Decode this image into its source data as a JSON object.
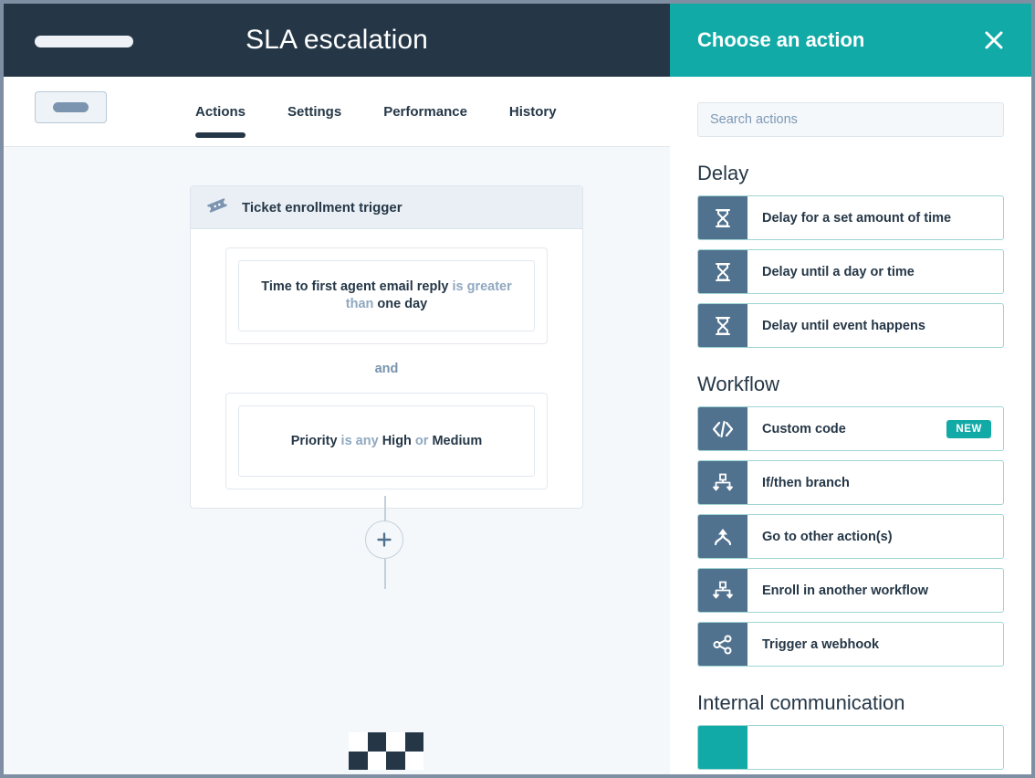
{
  "window": {
    "title": "SLA escalation"
  },
  "topbar": {
    "title": "SLA escalation",
    "left_pill": ""
  },
  "tabs": {
    "back_button_label": "",
    "items": [
      {
        "label": "Actions",
        "active": true
      },
      {
        "label": "Settings",
        "active": false
      },
      {
        "label": "Performance",
        "active": false
      },
      {
        "label": "History",
        "active": false
      }
    ]
  },
  "canvas": {
    "trigger": {
      "title": "Ticket enrollment trigger",
      "icon": "ticket-icon",
      "filters": [
        {
          "parts": [
            {
              "text": "Time to first agent email reply",
              "style": "bold"
            },
            {
              "text": " is greater than ",
              "style": "op"
            },
            {
              "text": "one day",
              "style": "bold"
            }
          ],
          "plain": "Time to first agent email reply is greater than one day"
        },
        {
          "parts": [
            {
              "text": "Priority",
              "style": "bold"
            },
            {
              "text": " is any ",
              "style": "op"
            },
            {
              "text": "High",
              "style": "bold"
            },
            {
              "text": " or ",
              "style": "op"
            },
            {
              "text": "Medium",
              "style": "bold"
            }
          ],
          "plain": "Priority is any High or Medium"
        }
      ],
      "conjunction": "and"
    },
    "add_action_button": "+"
  },
  "panel": {
    "title": "Choose an action",
    "close_icon": "close-icon",
    "search": {
      "placeholder": "Search actions",
      "value": ""
    },
    "sections": [
      {
        "title": "Delay",
        "items": [
          {
            "label": "Delay for a set amount of time",
            "icon": "hourglass-icon",
            "icon_color": "#51728f",
            "badge": ""
          },
          {
            "label": "Delay until a day or time",
            "icon": "hourglass-icon",
            "icon_color": "#51728f",
            "badge": ""
          },
          {
            "label": "Delay until event happens",
            "icon": "hourglass-icon",
            "icon_color": "#51728f",
            "badge": ""
          }
        ]
      },
      {
        "title": "Workflow",
        "items": [
          {
            "label": "Custom code",
            "icon": "code-icon",
            "icon_color": "#51728f",
            "badge": "NEW"
          },
          {
            "label": "If/then branch",
            "icon": "branch-icon",
            "icon_color": "#51728f",
            "badge": ""
          },
          {
            "label": "Go to other action(s)",
            "icon": "merge-arrow-icon",
            "icon_color": "#51728f",
            "badge": ""
          },
          {
            "label": "Enroll in another workflow",
            "icon": "branch-icon",
            "icon_color": "#51728f",
            "badge": ""
          },
          {
            "label": "Trigger a webhook",
            "icon": "share-icon",
            "icon_color": "#51728f",
            "badge": ""
          }
        ]
      },
      {
        "title": "Internal communication",
        "items": [
          {
            "label": "",
            "icon": "",
            "icon_color": "#12aaa6",
            "badge": ""
          }
        ]
      }
    ]
  },
  "colors": {
    "navy": "#253747",
    "teal": "#12aaa6",
    "slate": "#51728f",
    "canvas_bg": "#f5f8fa",
    "border_teal": "#9ed5d3"
  }
}
